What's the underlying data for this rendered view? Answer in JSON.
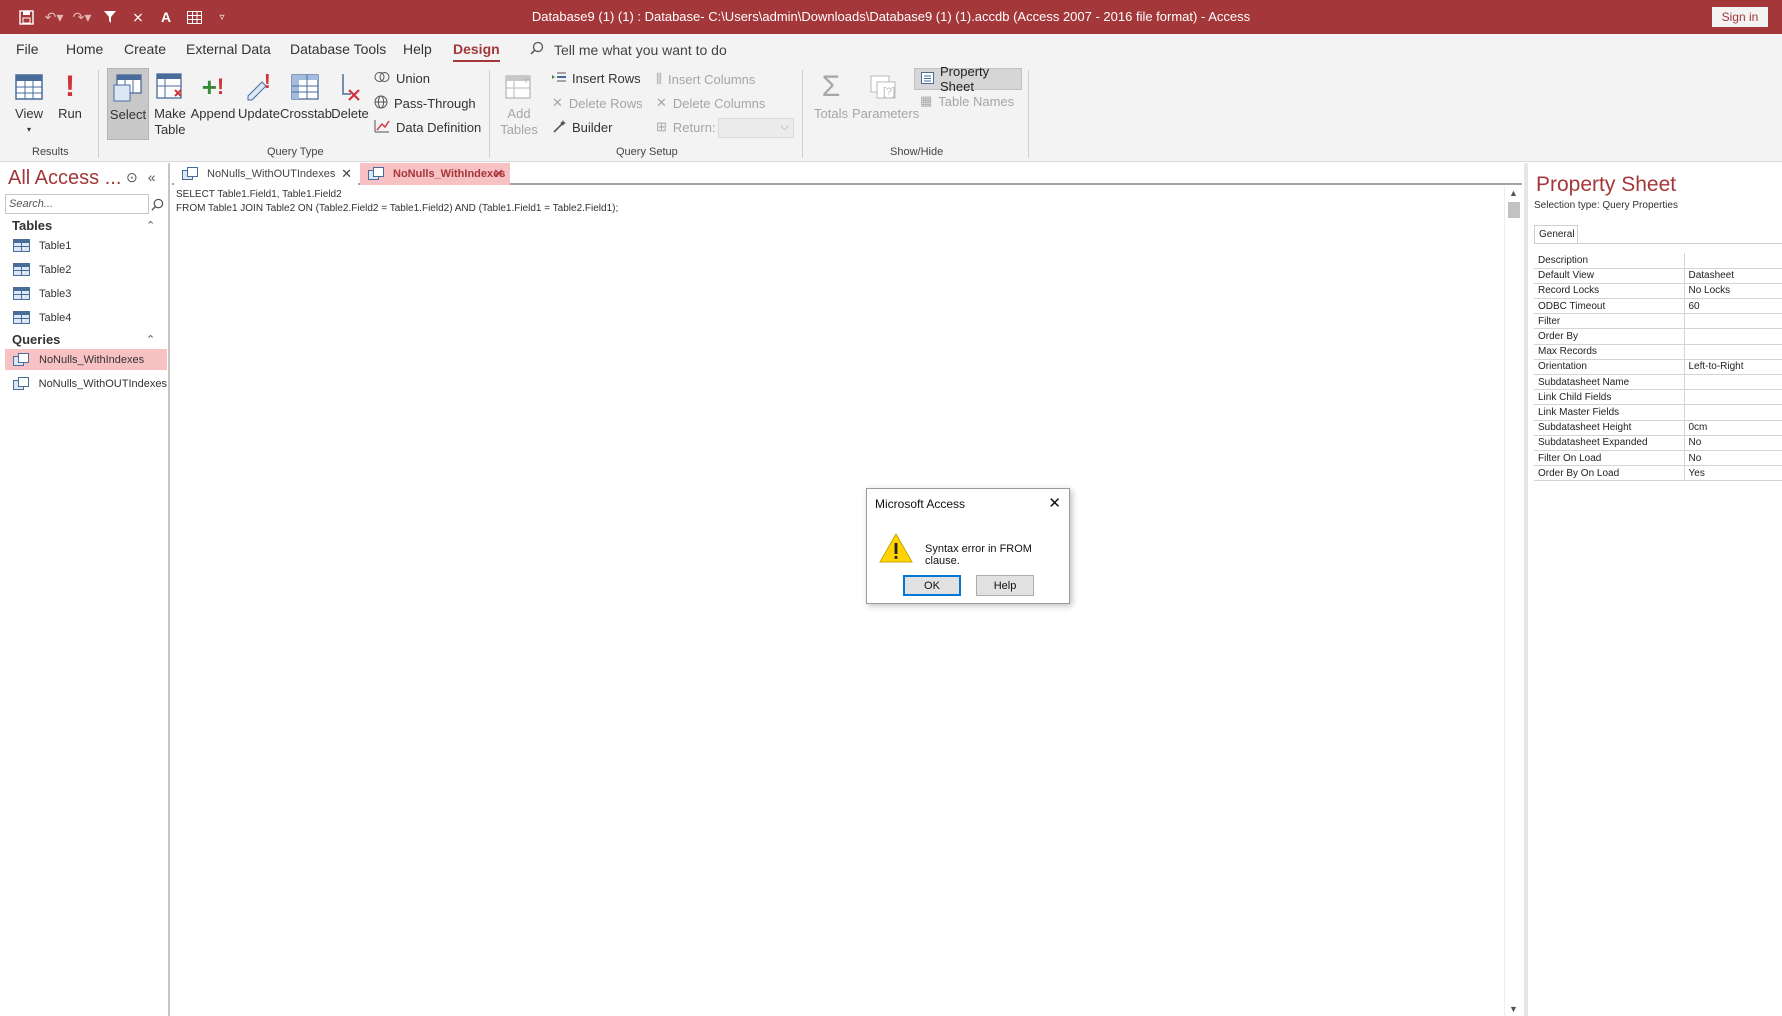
{
  "window": {
    "title": "Database9 (1) (1) : Database- C:\\Users\\admin\\Downloads\\Database9 (1) (1).accdb (Access 2007 - 2016 file format)  -  Access",
    "sign_in": "Sign in"
  },
  "menu": {
    "file": "File",
    "home": "Home",
    "create": "Create",
    "external_data": "External Data",
    "database_tools": "Database Tools",
    "help": "Help",
    "design": "Design",
    "tell_me": "Tell me what you want to do"
  },
  "ribbon": {
    "results": {
      "view": "View",
      "run": "Run",
      "group": "Results"
    },
    "query_type": {
      "select": "Select",
      "make_table_1": "Make",
      "make_table_2": "Table",
      "append": "Append",
      "update": "Update",
      "crosstab": "Crosstab",
      "delete": "Delete",
      "union": "Union",
      "pass_through": "Pass-Through",
      "data_definition": "Data Definition",
      "group": "Query Type"
    },
    "query_setup": {
      "add_tables_1": "Add",
      "add_tables_2": "Tables",
      "insert_rows": "Insert Rows",
      "delete_rows": "Delete Rows",
      "builder": "Builder",
      "insert_columns": "Insert Columns",
      "delete_columns": "Delete Columns",
      "return": "Return:",
      "group": "Query Setup"
    },
    "show_hide": {
      "totals": "Totals",
      "parameters": "Parameters",
      "property_sheet": "Property Sheet",
      "table_names": "Table Names",
      "group": "Show/Hide"
    }
  },
  "nav": {
    "title": "All Access ...",
    "search_placeholder": "Search...",
    "tables_label": "Tables",
    "tables": [
      "Table1",
      "Table2",
      "Table3",
      "Table4"
    ],
    "queries_label": "Queries",
    "queries": [
      "NoNulls_WithIndexes",
      "NoNulls_WithOUTIndexes"
    ]
  },
  "tabs": {
    "inactive": "NoNulls_WithOUTIndexes",
    "active": "NoNulls_WithIndexes"
  },
  "editor": {
    "line1": "SELECT Table1.Field1, Table1.Field2",
    "line2": "FROM Table1  JOIN Table2 ON (Table2.Field2 = Table1.Field2) AND (Table1.Field1 = Table2.Field1);"
  },
  "property_sheet": {
    "title": "Property Sheet",
    "selection_type": "Selection type:  Query Properties",
    "tab": "General",
    "rows": [
      {
        "k": "Description",
        "v": ""
      },
      {
        "k": "Default View",
        "v": "Datasheet"
      },
      {
        "k": "Record Locks",
        "v": "No Locks"
      },
      {
        "k": "ODBC Timeout",
        "v": "60"
      },
      {
        "k": "Filter",
        "v": ""
      },
      {
        "k": "Order By",
        "v": ""
      },
      {
        "k": "Max Records",
        "v": ""
      },
      {
        "k": "Orientation",
        "v": "Left-to-Right"
      },
      {
        "k": "Subdatasheet Name",
        "v": ""
      },
      {
        "k": "Link Child Fields",
        "v": ""
      },
      {
        "k": "Link Master Fields",
        "v": ""
      },
      {
        "k": "Subdatasheet Height",
        "v": "0cm"
      },
      {
        "k": "Subdatasheet Expanded",
        "v": "No"
      },
      {
        "k": "Filter On Load",
        "v": "No"
      },
      {
        "k": "Order By On Load",
        "v": "Yes"
      }
    ]
  },
  "dialog": {
    "title": "Microsoft Access",
    "message": "Syntax error in FROM clause.",
    "ok": "OK",
    "help": "Help"
  },
  "colors": {
    "accent": "#a4373a",
    "selection": "#f8c1c4"
  }
}
